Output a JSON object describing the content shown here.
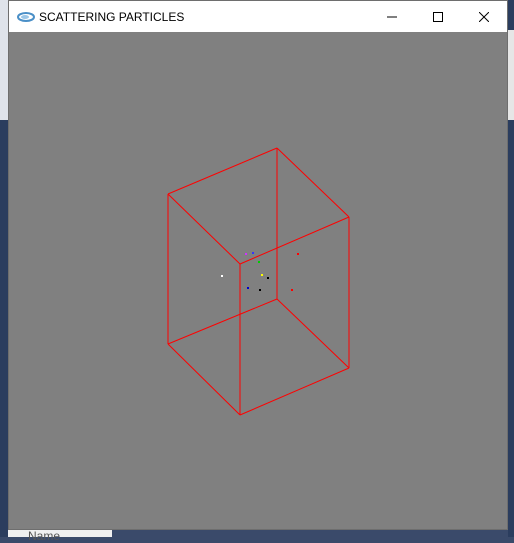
{
  "window": {
    "title": "SCATTERING PARTICLES",
    "controls": {
      "minimize": "minimize",
      "maximize": "maximize",
      "close": "close"
    }
  },
  "background": {
    "bottom_label": "Name"
  },
  "scene": {
    "background_color": "#808080",
    "box_color": "#ff0000",
    "particles": [
      {
        "color": "#ffffff"
      },
      {
        "color": "#cc33ff"
      },
      {
        "color": "#3333ff"
      },
      {
        "color": "#00cc00"
      },
      {
        "color": "#ffff00"
      },
      {
        "color": "#000000"
      },
      {
        "color": "#000000"
      },
      {
        "color": "#0000cc"
      },
      {
        "color": "#ff0000"
      },
      {
        "color": "#ff0000"
      }
    ]
  }
}
